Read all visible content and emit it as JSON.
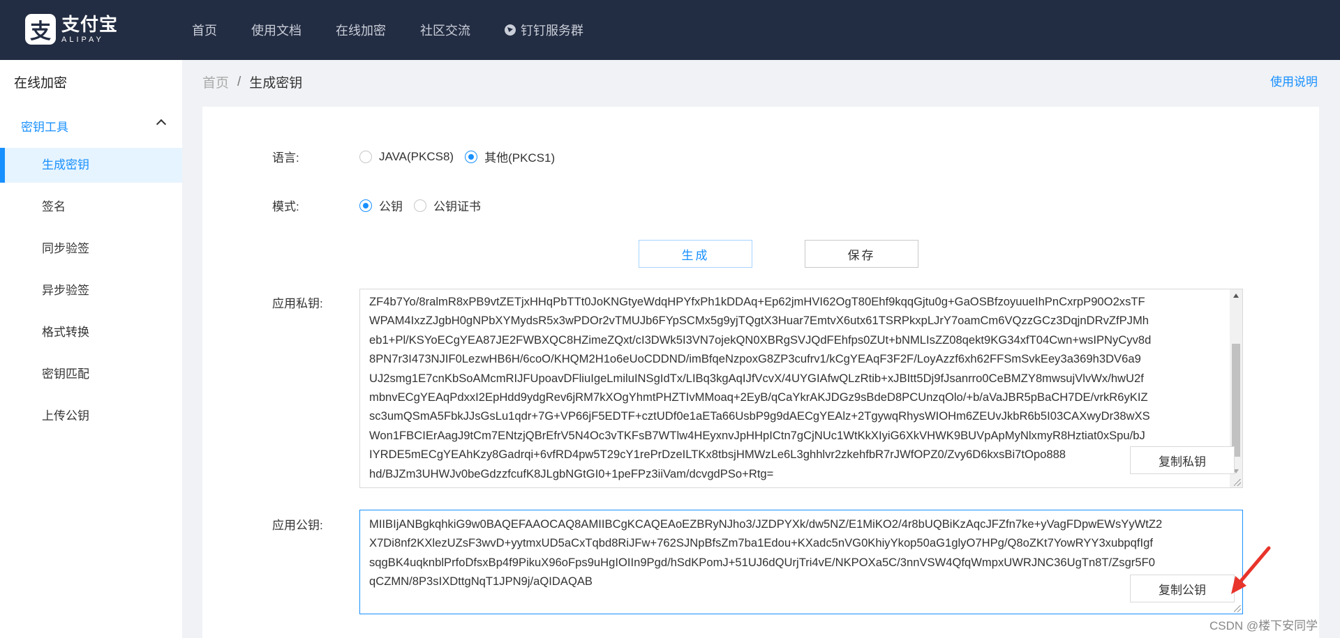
{
  "header": {
    "logo_cn": "支付宝",
    "logo_en": "ALIPAY",
    "logo_mark": "支",
    "nav": [
      "首页",
      "使用文档",
      "在线加密",
      "社区交流",
      "钉钉服务群"
    ]
  },
  "sidebar": {
    "title": "在线加密",
    "group": "密钥工具",
    "items": [
      "生成密钥",
      "签名",
      "同步验签",
      "异步验签",
      "格式转换",
      "密钥匹配",
      "上传公钥"
    ]
  },
  "breadcrumb": {
    "home": "首页",
    "sep": "/",
    "current": "生成密钥"
  },
  "help_link": "使用说明",
  "form": {
    "language_label": "语言:",
    "language_options": [
      "JAVA(PKCS8)",
      "其他(PKCS1)"
    ],
    "language_selected": "其他(PKCS1)",
    "mode_label": "模式:",
    "mode_options": [
      "公钥",
      "公钥证书"
    ],
    "mode_selected": "公钥",
    "generate_button": "生成",
    "save_button": "保存",
    "private_key_label": "应用私钥:",
    "private_key_text": "ZF4b7Yo/8ralmR8xPB9vtZETjxHHqPbTTt0JoKNGtyeWdqHPYfxPh1kDDAq+Ep62jmHVI62OgT80Ehf9kqqGjtu0g+GaOSBfzoyuueIhPnCxrpP90O2xsTF\nWPAM4IxzZJgbH0gNPbXYMydsR5x3wPDOr2vTMUJb6FYpSCMx5g9yjTQgtX3Huar7EmtvX6utx61TSRPkxpLJrY7oamCm6VQzzGCz3DqjnDRvZfPJMh\neb1+Pl/KSYoECgYEA87JE2FWBXQC8HZimeZQxt/cI3DWk5I3VN7ojekQN0XBRgSVJQdFEhfps0ZUt+bNMLIsZZ08qekt9KG34xfT04Cwn+wsIPNyCyv8d\n8PN7r3I473NJIF0LezwHB6H/6coO/KHQM2H1o6eUoCDDND/imBfqeNzpoxG8ZP3cufrv1/kCgYEAqF3F2F/LoyAzzf6xh62FFSmSvkEey3a369h3DV6a9\nUJ2smg1E7cnKbSoAMcmRIJFUpoavDFliuIgeLmiluINSgIdTx/LIBq3kgAqIJfVcvX/4UYGIAfwQLzRtib+xJBItt5Dj9fJsanrro0CeBMZY8mwsujVlvWx/hwU2f\nmbnvECgYEAqPdxxI2EpHdd9ydgRev6jRM7kXOgYhmtPHZTIvMMoaq+2EyB/qCaYkrAKJDGz9sBdeD8PCUnzqOlo/+b/aVaJBR5pBaCH7DE/vrkR6yKIZ\nsc3umQSmA5FbkJJsGsLu1qdr+7G+VP66jF5EDTF+cztUDf0e1aETa66UsbP9g9dAECgYEAlz+2TgywqRhysWIOHm6ZEUvJkbR6b5I03CAXwyDr38wXS\nWon1FBCIErAagJ9tCm7ENtzjQBrEfrV5N4Oc3vTKFsB7WTlw4HEyxnvJpHHpICtn7gCjNUc1WtKkXIyiG6XkVHWK9BUVpApMyNlxmyR8Hztiat0xSpu/bJ\nIYRDE5mECgYEAhKzy8Gadrqi+6vfRD4pw5T29cY1rePrDzeILTKx8tbsjHMWzLe6L3ghhlvr2zkehfbR7rJWfOPZ0/Zvy6D6kxsBi7tOpo888\nhd/BJZm3UHWJv0beGdzzfcufK8JLgbNGtGI0+1peFPz3iiVam/dcvgdPSo+Rtg=",
    "copy_private_button": "复制私钥",
    "public_key_label": "应用公钥:",
    "public_key_text": "MIIBIjANBgkqhkiG9w0BAQEFAAOCAQ8AMIIBCgKCAQEAoEZBRyNJho3/JZDPYXk/dw5NZ/E1MiKO2/4r8bUQBiKzAqcJFZfn7ke+yVagFDpwEWsYyWtZ2\nX7Di8nf2KXlezUZsF3wvD+yytmxUD5aCxTqbd8RiJFw+762SJNpBfsZm7ba1Edou+KXadc5nVG0KhiyYkop50aG1glyO7HPg/Q8oZKt7YowRYY3xubpqfIgf\nsqgBK4uqknblPrfoDfsxBp4f9PikuX96oFps9uHgIOIIn9Pgd/hSdKPomJ+51UJ6dQUrjTri4vE/NKPOXa5C/3nnVSW4QfqWmpxUWRJNC36UgTn8T/Zsgr5F0\nqCZMN/8P3sIXDttgNqT1JPN9j/aQIDAQAB",
    "copy_public_button": "复制公钥"
  },
  "watermark": "CSDN @楼下安同学",
  "colors": {
    "nav_bg": "#222c42",
    "accent": "#1890ff",
    "arrow": "#e8342b"
  }
}
